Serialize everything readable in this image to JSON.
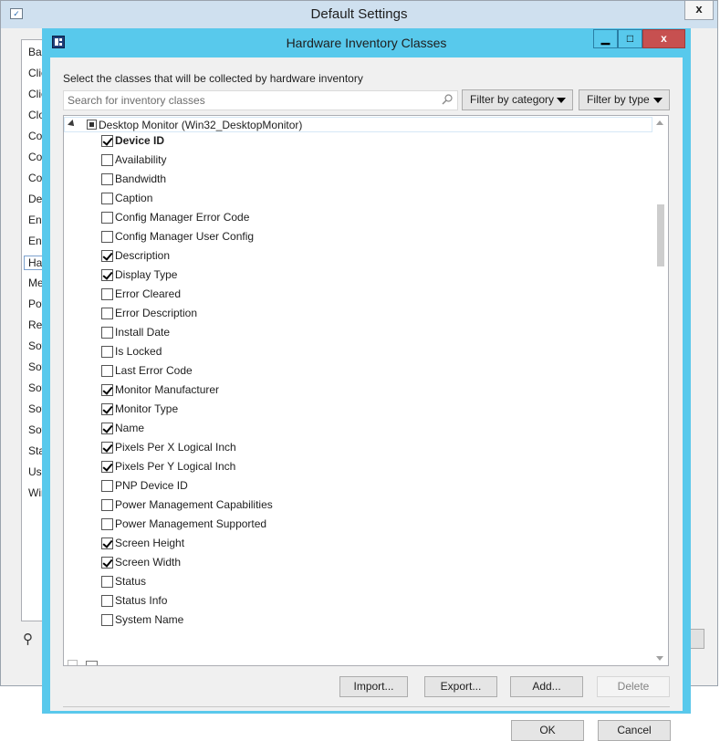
{
  "background_window": {
    "title": "Default Settings",
    "close_label": "x",
    "sidebar_items": [
      "Bac",
      "Clie",
      "Clie",
      "Clo",
      "Co",
      "Co",
      "Co",
      "Del",
      "End",
      "Enr",
      "Ha",
      "Me",
      "Pov",
      "Ren",
      "Sof",
      "Sof",
      "Sof",
      "Sof",
      "Sof",
      "Sta",
      "Use",
      "Win"
    ],
    "selected_index": 10
  },
  "dialog": {
    "title": "Hardware Inventory Classes",
    "controls": {
      "minimize": "▁",
      "maximize": "□",
      "close": "x"
    },
    "instruction": "Select the classes that will be collected by hardware inventory",
    "search_placeholder": "Search for inventory classes",
    "filter_category_label": "Filter by category",
    "filter_type_label": "Filter by type",
    "parent_class": "Desktop Monitor (Win32_DesktopMonitor)",
    "properties": [
      {
        "label": "Device ID",
        "checked": true,
        "bold": true
      },
      {
        "label": "Availability",
        "checked": false
      },
      {
        "label": "Bandwidth",
        "checked": false
      },
      {
        "label": "Caption",
        "checked": false
      },
      {
        "label": "Config Manager Error Code",
        "checked": false
      },
      {
        "label": "Config Manager User Config",
        "checked": false
      },
      {
        "label": "Description",
        "checked": true
      },
      {
        "label": "Display Type",
        "checked": true
      },
      {
        "label": "Error Cleared",
        "checked": false
      },
      {
        "label": "Error Description",
        "checked": false
      },
      {
        "label": "Install Date",
        "checked": false
      },
      {
        "label": "Is Locked",
        "checked": false
      },
      {
        "label": "Last Error Code",
        "checked": false
      },
      {
        "label": "Monitor Manufacturer",
        "checked": true
      },
      {
        "label": "Monitor Type",
        "checked": true
      },
      {
        "label": "Name",
        "checked": true
      },
      {
        "label": "Pixels Per X Logical Inch",
        "checked": true
      },
      {
        "label": "Pixels Per Y Logical Inch",
        "checked": true
      },
      {
        "label": "PNP Device ID",
        "checked": false
      },
      {
        "label": "Power Management Capabilities",
        "checked": false
      },
      {
        "label": "Power Management Supported",
        "checked": false
      },
      {
        "label": "Screen Height",
        "checked": true
      },
      {
        "label": "Screen Width",
        "checked": true
      },
      {
        "label": "Status",
        "checked": false
      },
      {
        "label": "Status Info",
        "checked": false
      },
      {
        "label": "System Name",
        "checked": false
      }
    ],
    "buttons": {
      "import": "Import...",
      "export": "Export...",
      "add": "Add...",
      "delete": "Delete",
      "ok": "OK",
      "cancel": "Cancel"
    }
  }
}
